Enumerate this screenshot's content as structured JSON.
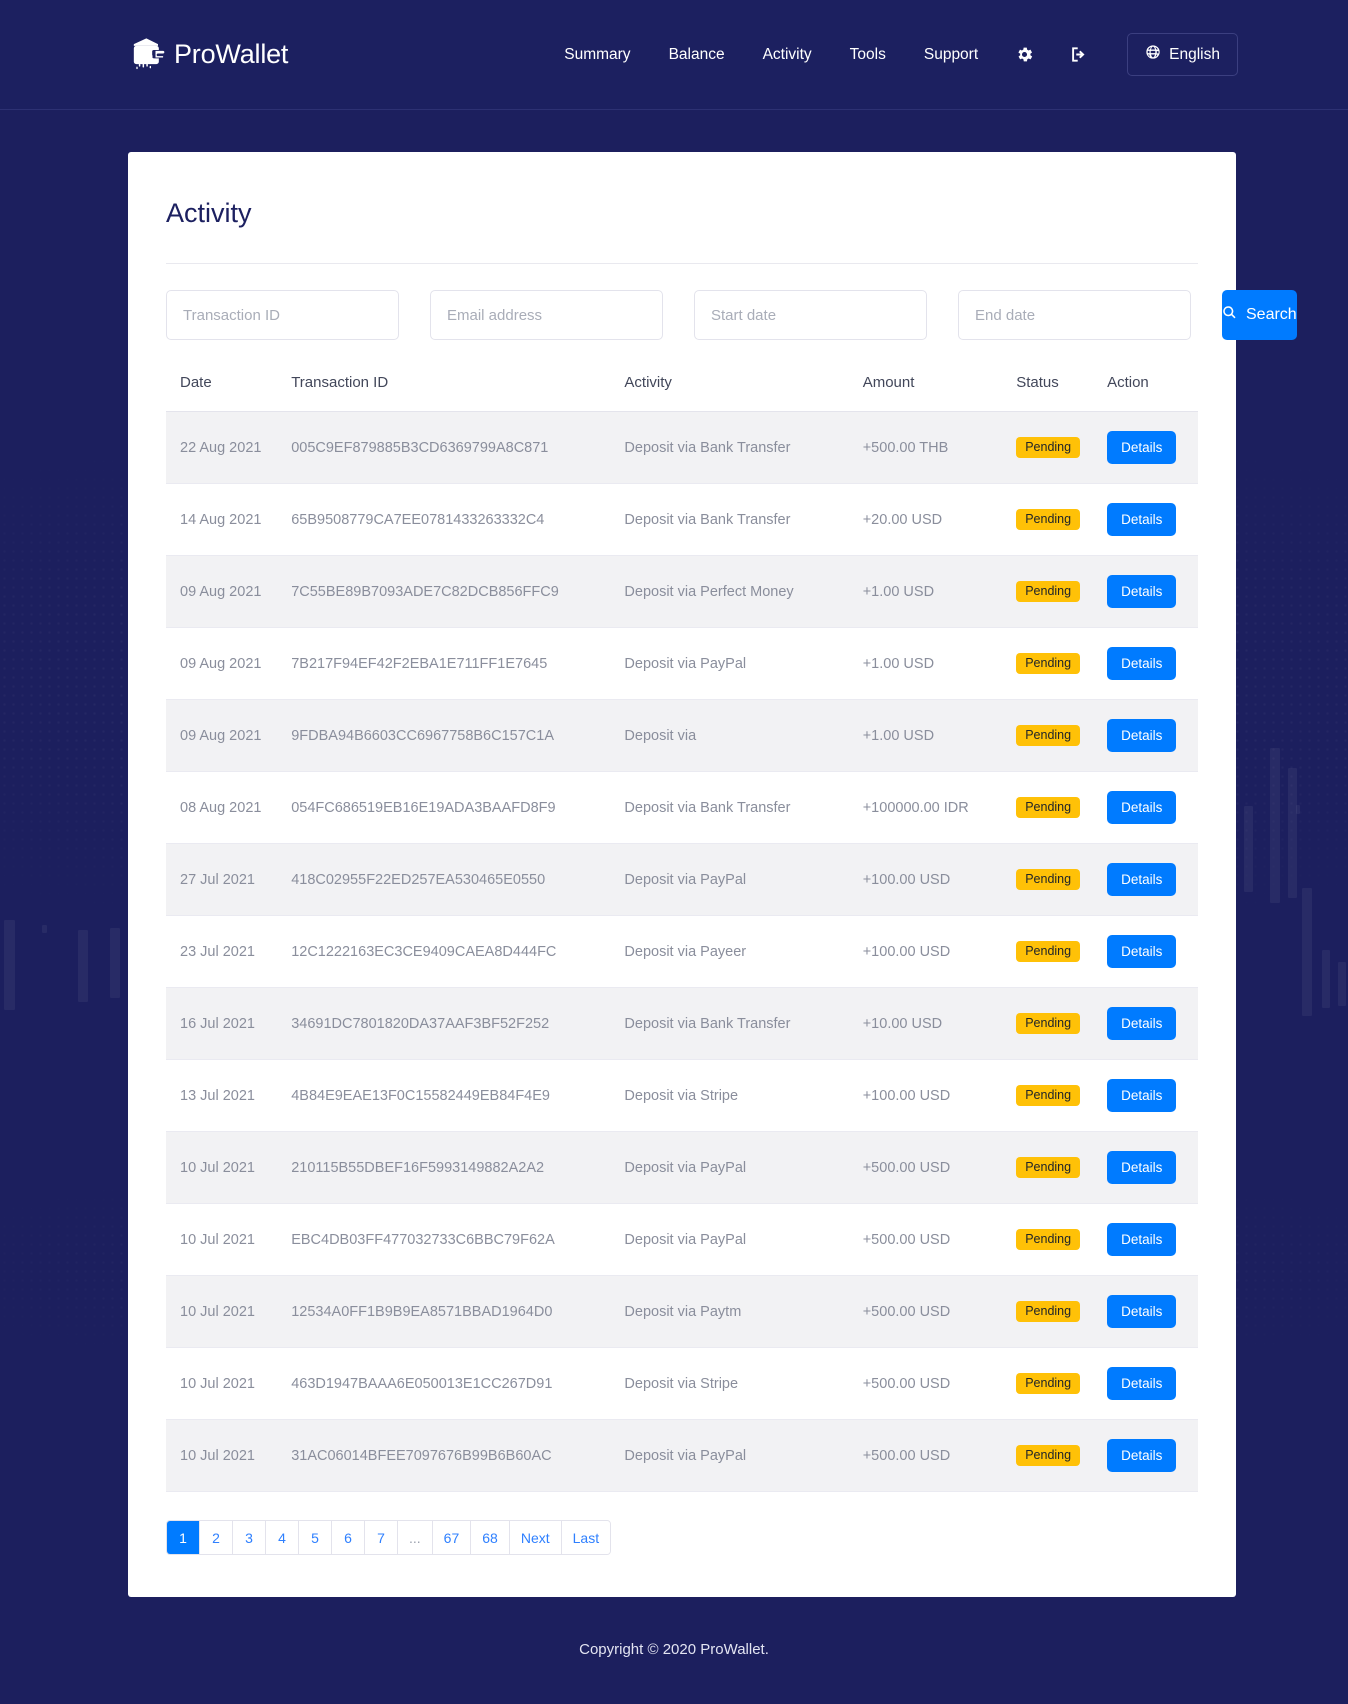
{
  "header": {
    "brand": {
      "name": "ProWallet",
      "icon": "wallet-cloud-icon"
    },
    "nav": [
      {
        "label": "Summary"
      },
      {
        "label": "Balance"
      },
      {
        "label": "Activity"
      },
      {
        "label": "Tools"
      },
      {
        "label": "Support"
      }
    ],
    "settings_icon": "gear-icon",
    "logout_icon": "sign-out-icon",
    "language": {
      "label": "English",
      "icon": "globe-icon"
    }
  },
  "main": {
    "title": "Activity",
    "filters": {
      "transaction_id_placeholder": "Transaction ID",
      "email_placeholder": "Email address",
      "start_date_placeholder": "Start date",
      "end_date_placeholder": "End date",
      "search_label": "Search",
      "search_icon": "search-icon"
    },
    "table": {
      "columns": [
        "Date",
        "Transaction ID",
        "Activity",
        "Amount",
        "Status",
        "Action"
      ],
      "action_label": "Details",
      "rows": [
        {
          "date": "22 Aug 2021",
          "txid": "005C9EF879885B3CD6369799A8C871",
          "activity": "Deposit via Bank Transfer",
          "amount": "+500.00 THB",
          "status": "Pending"
        },
        {
          "date": "14 Aug 2021",
          "txid": "65B9508779CA7EE0781433263332C4",
          "activity": "Deposit via Bank Transfer",
          "amount": "+20.00 USD",
          "status": "Pending"
        },
        {
          "date": "09 Aug 2021",
          "txid": "7C55BE89B7093ADE7C82DCB856FFC9",
          "activity": "Deposit via Perfect Money",
          "amount": "+1.00 USD",
          "status": "Pending"
        },
        {
          "date": "09 Aug 2021",
          "txid": "7B217F94EF42F2EBA1E711FF1E7645",
          "activity": "Deposit via PayPal",
          "amount": "+1.00 USD",
          "status": "Pending"
        },
        {
          "date": "09 Aug 2021",
          "txid": "9FDBA94B6603CC6967758B6C157C1A",
          "activity": "Deposit via",
          "amount": "+1.00 USD",
          "status": "Pending"
        },
        {
          "date": "08 Aug 2021",
          "txid": "054FC686519EB16E19ADA3BAAFD8F9",
          "activity": "Deposit via Bank Transfer",
          "amount": "+100000.00 IDR",
          "status": "Pending"
        },
        {
          "date": "27 Jul 2021",
          "txid": "418C02955F22ED257EA530465E0550",
          "activity": "Deposit via PayPal",
          "amount": "+100.00 USD",
          "status": "Pending"
        },
        {
          "date": "23 Jul 2021",
          "txid": "12C1222163EC3CE9409CAEA8D444FC",
          "activity": "Deposit via Payeer",
          "amount": "+100.00 USD",
          "status": "Pending"
        },
        {
          "date": "16 Jul 2021",
          "txid": "34691DC7801820DA37AAF3BF52F252",
          "activity": "Deposit via Bank Transfer",
          "amount": "+10.00 USD",
          "status": "Pending"
        },
        {
          "date": "13 Jul 2021",
          "txid": "4B84E9EAE13F0C15582449EB84F4E9",
          "activity": "Deposit via Stripe",
          "amount": "+100.00 USD",
          "status": "Pending"
        },
        {
          "date": "10 Jul 2021",
          "txid": "210115B55DBEF16F5993149882A2A2",
          "activity": "Deposit via PayPal",
          "amount": "+500.00 USD",
          "status": "Pending"
        },
        {
          "date": "10 Jul 2021",
          "txid": "EBC4DB03FF477032733C6BBC79F62A",
          "activity": "Deposit via PayPal",
          "amount": "+500.00 USD",
          "status": "Pending"
        },
        {
          "date": "10 Jul 2021",
          "txid": "12534A0FF1B9B9EA8571BBAD1964D0",
          "activity": "Deposit via Paytm",
          "amount": "+500.00 USD",
          "status": "Pending"
        },
        {
          "date": "10 Jul 2021",
          "txid": "463D1947BAAA6E050013E1CC267D91",
          "activity": "Deposit via Stripe",
          "amount": "+500.00 USD",
          "status": "Pending"
        },
        {
          "date": "10 Jul 2021",
          "txid": "31AC06014BFEE7097676B99B6B60AC",
          "activity": "Deposit via PayPal",
          "amount": "+500.00 USD",
          "status": "Pending"
        }
      ]
    },
    "pagination": {
      "current": "1",
      "items": [
        "1",
        "2",
        "3",
        "4",
        "5",
        "6",
        "7",
        "...",
        "67",
        "68",
        "Next",
        "Last"
      ]
    }
  },
  "footer": {
    "copyright": "Copyright © 2020 ProWallet."
  },
  "colors": {
    "page_bg": "#1c1f5e",
    "header_bg": "#1c2060",
    "accent_blue": "#007bff",
    "badge_amber": "#ffc107",
    "card_bg": "#ffffff",
    "row_stripe": "#f2f2f4"
  }
}
